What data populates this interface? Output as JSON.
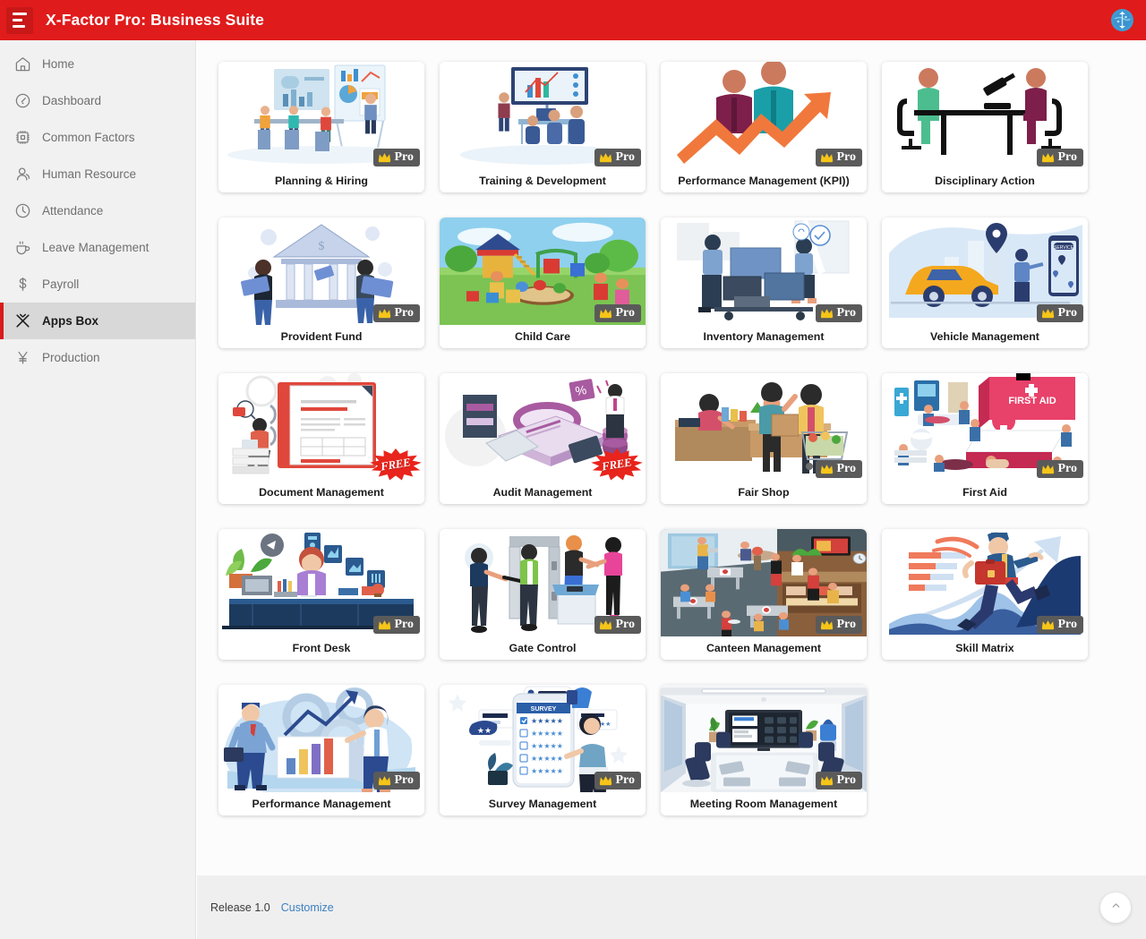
{
  "topbar": {
    "menu_icon": "hamburger-icon",
    "title": "X-Factor Pro: Business Suite",
    "avatar_icon": "user-avatar-globe-icon",
    "background_color": "#e01b1b"
  },
  "sidebar": {
    "active_item": "Apps Box",
    "accent_color": "#d81b1b",
    "items": [
      {
        "label": "Home",
        "icon": "home-icon"
      },
      {
        "label": "Dashboard",
        "icon": "dashboard-gauge-icon"
      },
      {
        "label": "Common Factors",
        "icon": "chip-icon"
      },
      {
        "label": "Human Resource",
        "icon": "person-icon"
      },
      {
        "label": "Attendance",
        "icon": "clock-icon"
      },
      {
        "label": "Leave Management",
        "icon": "coffee-cup-icon"
      },
      {
        "label": "Payroll",
        "icon": "dollar-icon"
      },
      {
        "label": "Apps Box",
        "icon": "apps-box-icon"
      },
      {
        "label": "Production",
        "icon": "yen-icon"
      }
    ]
  },
  "apps": {
    "badge_pro_label": "Pro",
    "badge_free_label": "FREE",
    "badge_pro_color": "#5a5a5a",
    "badge_free_color": "#e8241c",
    "items": [
      {
        "label": "Planning & Hiring",
        "badge": "Pro",
        "art": "planning"
      },
      {
        "label": "Training & Development",
        "badge": "Pro",
        "art": "training"
      },
      {
        "label": "Performance Management (KPI))",
        "badge": "Pro",
        "art": "kpi"
      },
      {
        "label": "Disciplinary Action",
        "badge": "Pro",
        "art": "disciplinary"
      },
      {
        "label": "Provident Fund",
        "badge": "Pro",
        "art": "provident"
      },
      {
        "label": "Child Care",
        "badge": "Pro",
        "art": "childcare",
        "bleed": true
      },
      {
        "label": "Inventory Management",
        "badge": "Pro",
        "art": "inventory"
      },
      {
        "label": "Vehicle Management",
        "badge": "Pro",
        "art": "vehicle"
      },
      {
        "label": "Document Management",
        "badge": "FREE",
        "art": "document"
      },
      {
        "label": "Audit Management",
        "badge": "FREE",
        "art": "audit"
      },
      {
        "label": "Fair Shop",
        "badge": "Pro",
        "art": "fairshop"
      },
      {
        "label": "First Aid",
        "badge": "Pro",
        "art": "firstaid"
      },
      {
        "label": "Front Desk",
        "badge": "Pro",
        "art": "frontdesk"
      },
      {
        "label": "Gate Control",
        "badge": "Pro",
        "art": "gate"
      },
      {
        "label": "Canteen Management",
        "badge": "Pro",
        "art": "canteen",
        "bleed": true
      },
      {
        "label": "Skill Matrix",
        "badge": "Pro",
        "art": "skill"
      },
      {
        "label": "Performance Management",
        "badge": "Pro",
        "art": "perf2"
      },
      {
        "label": "Survey Management",
        "badge": "Pro",
        "art": "survey"
      },
      {
        "label": "Meeting Room Management",
        "badge": "Pro",
        "art": "meeting",
        "bleed": true
      }
    ]
  },
  "footer": {
    "release": "Release 1.0",
    "customize": "Customize",
    "scroll_top_icon": "chevron-up-icon"
  }
}
